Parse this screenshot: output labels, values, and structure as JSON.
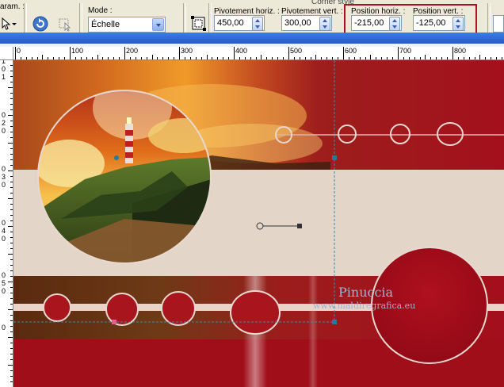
{
  "toolbar": {
    "param_label": "aram. :",
    "mode": {
      "label": "Mode :",
      "value": "Échelle"
    },
    "corner_style_label": "Corner style",
    "pivot_h": {
      "label": "Pivotement horiz. :",
      "value": "450,00"
    },
    "pivot_v": {
      "label": "Pivotement vert. :",
      "value": "300,00"
    },
    "pos_h": {
      "label": "Position horiz. :",
      "value": "-215,00"
    },
    "pos_v": {
      "label": "Position vert. :",
      "value": "-125,00"
    },
    "highlight_color": "#b01020"
  },
  "ruler": {
    "top_labels": [
      "0",
      "100",
      "200",
      "300",
      "400",
      "500",
      "600",
      "700",
      "800"
    ],
    "left_labels": [
      "1",
      "0",
      "1",
      "0",
      "2",
      "0",
      "0",
      "3",
      "0",
      "0",
      "4",
      "0",
      "0",
      "5",
      "0",
      "0"
    ]
  },
  "watermark": {
    "name": "Pinuccia",
    "site": "www.maldiregrafica.eu"
  },
  "colors": {
    "dark_red": "#9d0d1a",
    "beige_band": "#e3d6c9",
    "ring": "#e9d8cf",
    "toolbar_bg": "#ece9d8"
  }
}
